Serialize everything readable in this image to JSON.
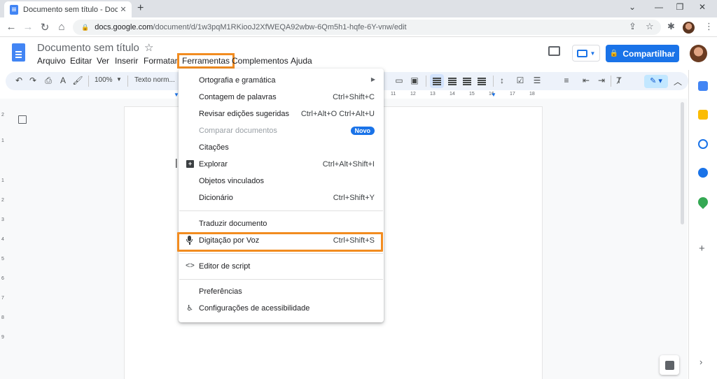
{
  "browser": {
    "tab_title": "Documento sem título - Docume",
    "url_host": "docs.google.com",
    "url_path": "/document/d/1w3pqM1RKiooJ2XfWEQA92wbw-6Qm5h1-hqfe-6Y-vnw/edit"
  },
  "doc": {
    "title": "Documento sem título",
    "menus": [
      "Arquivo",
      "Editar",
      "Ver",
      "Inserir",
      "Formatar",
      "Ferramentas",
      "Complementos",
      "Ajuda"
    ],
    "share_label": "Compartilhar"
  },
  "toolbar": {
    "zoom": "100%",
    "style": "Texto norm..."
  },
  "ruler": {
    "numbers": [
      "11",
      "12",
      "13",
      "14",
      "15",
      "16",
      "17",
      "18"
    ],
    "left_numbers": [
      "2",
      "1",
      "1",
      "2",
      "3",
      "4",
      "5",
      "6",
      "7",
      "8",
      "9"
    ]
  },
  "tools_menu": {
    "items": [
      {
        "label": "Ortografia e gramática",
        "shortcut": "",
        "submenu": true
      },
      {
        "label": "Contagem de palavras",
        "shortcut": "Ctrl+Shift+C"
      },
      {
        "label": "Revisar edições sugeridas",
        "shortcut": "Ctrl+Alt+O Ctrl+Alt+U"
      },
      {
        "label": "Comparar documentos",
        "shortcut": "",
        "badge": "Novo",
        "disabled": true
      },
      {
        "label": "Citações",
        "shortcut": ""
      },
      {
        "label": "Explorar",
        "shortcut": "Ctrl+Alt+Shift+I",
        "icon": "explore-icon"
      },
      {
        "label": "Objetos vinculados",
        "shortcut": ""
      },
      {
        "label": "Dicionário",
        "shortcut": "Ctrl+Shift+Y"
      },
      {
        "label": "Traduzir documento",
        "shortcut": ""
      },
      {
        "label": "Digitação por Voz",
        "shortcut": "Ctrl+Shift+S",
        "icon": "microphone-icon"
      },
      {
        "label": "Editor de script",
        "shortcut": "",
        "icon": "code-icon"
      },
      {
        "label": "Preferências",
        "shortcut": ""
      },
      {
        "label": "Configurações de acessibilidade",
        "shortcut": "",
        "icon": "accessibility-icon"
      }
    ]
  },
  "colors": {
    "highlight": "#f28c20",
    "primary": "#1a73e8"
  }
}
